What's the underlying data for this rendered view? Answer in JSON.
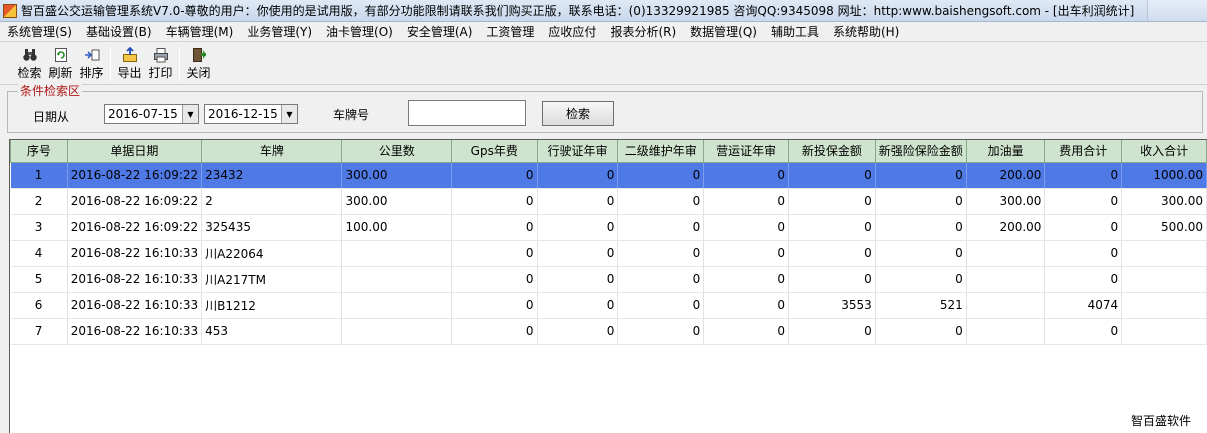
{
  "window": {
    "title": "智百盛公交运输管理系统V7.0-尊敬的用户：你使用的是试用版，有部分功能限制请联系我们购买正版，联系电话：(0)13329921985 咨询QQ:9345098 网址：http:www.baishengsoft.com - [出车利润统计]"
  },
  "menu": [
    "系统管理(S)",
    "基础设置(B)",
    "车辆管理(M)",
    "业务管理(Y)",
    "油卡管理(O)",
    "安全管理(A)",
    "工资管理",
    "应收应付",
    "报表分析(R)",
    "数据管理(Q)",
    "辅助工具",
    "系统帮助(H)"
  ],
  "toolbar": {
    "search": "检索",
    "refresh": "刷新",
    "sort": "排序",
    "export": "导出",
    "print": "打印",
    "close": "关闭"
  },
  "filter": {
    "legend": "条件检索区",
    "date_label": "日期从",
    "date_from": "2016-07-15",
    "date_to": "2016-12-15",
    "plate_label": "车牌号",
    "plate_value": "",
    "search_button": "检索"
  },
  "table": {
    "columns": [
      "序号",
      "单据日期",
      "车牌",
      "公里数",
      "Gps年费",
      "行驶证年审",
      "二级维护年审",
      "营运证年审",
      "新投保金额",
      "新强险保险金额",
      "加油量",
      "费用合计",
      "收入合计"
    ],
    "rows": [
      [
        "1",
        "2016-08-22 16:09:22",
        "23432",
        "300.00",
        "0",
        "0",
        "0",
        "0",
        "0",
        "0",
        "200.00",
        "0",
        "1000.00"
      ],
      [
        "2",
        "2016-08-22 16:09:22",
        "2",
        "300.00",
        "0",
        "0",
        "0",
        "0",
        "0",
        "0",
        "300.00",
        "0",
        "300.00"
      ],
      [
        "3",
        "2016-08-22 16:09:22",
        "325435",
        "100.00",
        "0",
        "0",
        "0",
        "0",
        "0",
        "0",
        "200.00",
        "0",
        "500.00"
      ],
      [
        "4",
        "2016-08-22 16:10:33",
        "川A22064",
        "",
        "0",
        "0",
        "0",
        "0",
        "0",
        "0",
        "",
        "0",
        ""
      ],
      [
        "5",
        "2016-08-22 16:10:33",
        "川A217TM",
        "",
        "0",
        "0",
        "0",
        "0",
        "0",
        "0",
        "",
        "0",
        ""
      ],
      [
        "6",
        "2016-08-22 16:10:33",
        "川B1212",
        "",
        "0",
        "0",
        "0",
        "0",
        "3553",
        "521",
        "",
        "4074",
        ""
      ],
      [
        "7",
        "2016-08-22 16:10:33",
        "453",
        "",
        "0",
        "0",
        "0",
        "0",
        "0",
        "0",
        "",
        "0",
        ""
      ]
    ],
    "selected_row": 0
  },
  "footer": {
    "brand": "智百盛软件"
  }
}
